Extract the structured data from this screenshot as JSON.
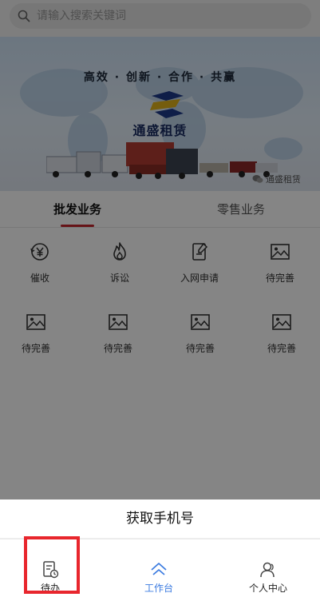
{
  "search": {
    "placeholder": "请输入搜索关键词"
  },
  "banner": {
    "slogan": "高效 · 创新 · 合作 · 共赢",
    "brand": "通盛租赁",
    "watermark": "通盛租赁"
  },
  "tabs": [
    {
      "label": "批发业务",
      "active": true
    },
    {
      "label": "零售业务",
      "active": false
    }
  ],
  "grid": [
    {
      "label": "催收",
      "icon": "yen-refresh-icon"
    },
    {
      "label": "诉讼",
      "icon": "flame-icon"
    },
    {
      "label": "入网申请",
      "icon": "edit-document-icon"
    },
    {
      "label": "待完善",
      "icon": "image-icon"
    },
    {
      "label": "待完善",
      "icon": "image-icon"
    },
    {
      "label": "待完善",
      "icon": "image-icon"
    },
    {
      "label": "待完善",
      "icon": "image-icon"
    },
    {
      "label": "待完善",
      "icon": "image-icon"
    }
  ],
  "sheet": {
    "title": "获取手机号"
  },
  "tabbar": [
    {
      "label": "待办",
      "icon": "todo-clock-icon",
      "active": false
    },
    {
      "label": "工作台",
      "icon": "home-icon",
      "active": true
    },
    {
      "label": "个人中心",
      "icon": "user-icon",
      "active": false
    }
  ],
  "colors": {
    "accent_red": "#c4262c",
    "active_blue": "#3b7be0",
    "highlight": "#e8262d"
  }
}
